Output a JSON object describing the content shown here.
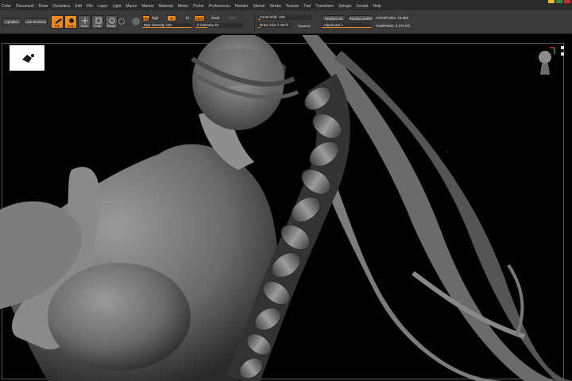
{
  "menu": [
    "Color",
    "Document",
    "Draw",
    "Dynamics",
    "Edit",
    "File",
    "Layer",
    "Light",
    "Macro",
    "Marker",
    "Material",
    "Movie",
    "Picker",
    "Preferences",
    "Render",
    "Stencil",
    "Stroke",
    "Texture",
    "Tool",
    "Transform",
    "Zplugin",
    "Zscript",
    "Help"
  ],
  "shelf": {
    "lightbox": "LightBox",
    "live_boolean": "Live Boolean",
    "edit": "Edit",
    "draw": "Draw",
    "move": "Move",
    "scale": "Scale",
    "rotate": "Rotate",
    "mrgb": "Mrgb",
    "rgb": "Rgb",
    "m": "M",
    "zadd": "Zadd",
    "zsub": "Zsub",
    "zcut": "Zcut",
    "rgb_intensity": "Rgb Intensity 100",
    "z_intensity": "Z Intensity 25",
    "focal_shift": "Focal Shift -100",
    "draw_size": "Draw Size 7.4673",
    "dynamic": "Dynamic",
    "replay_last": "ReplayLast",
    "replay_last_rel": "ReplayLastRel",
    "adjust_last": "AdjustLast 1",
    "active_points": "ActivePoints: 76.839",
    "total_points": "TotalPoints: 3.470 Mil"
  },
  "colors": {
    "accent": "#f08a1a",
    "menubar": "#2b2b2b",
    "shelf": "#3a3a3a",
    "canvas": "#000000"
  },
  "icons": {
    "nav_cube": "head-orientation-icon",
    "thumbnail": "model-thumbnail-icon"
  }
}
